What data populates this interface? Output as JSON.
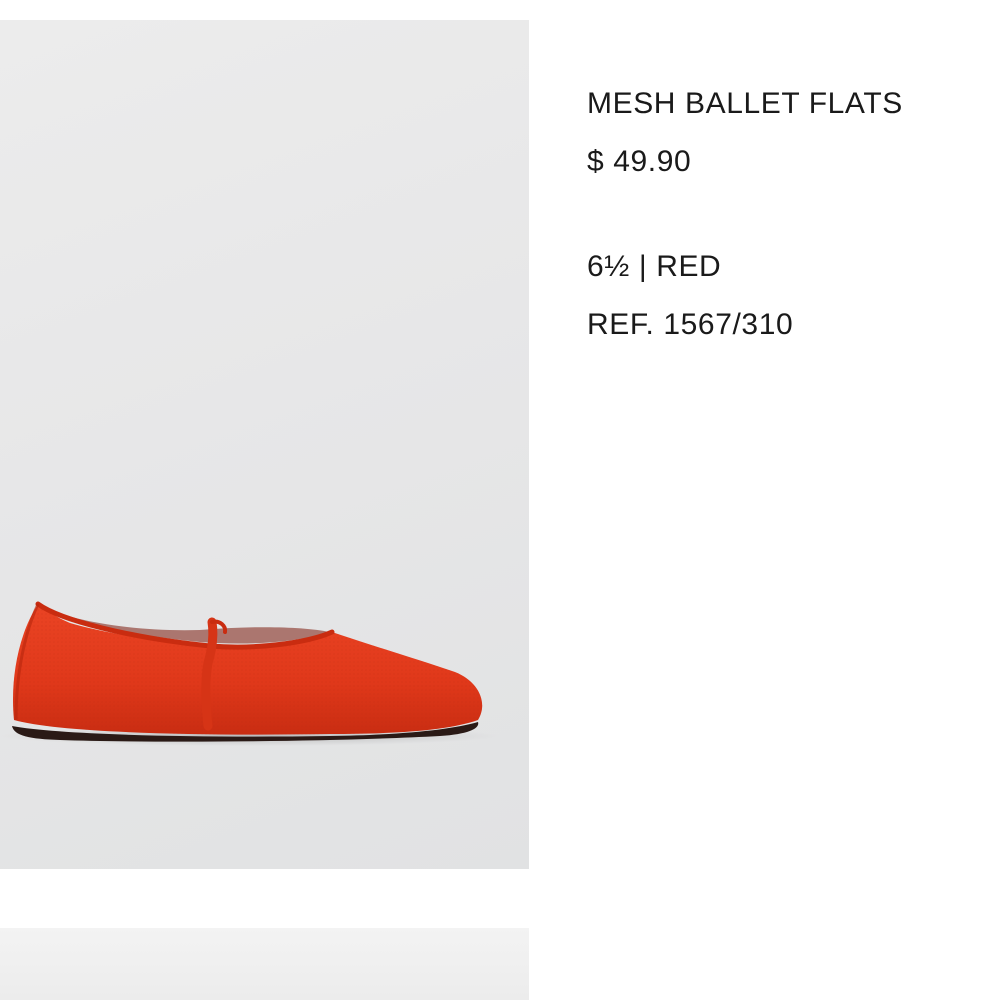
{
  "product": {
    "name": "MESH BALLET FLATS",
    "price": "$ 49.90",
    "size": "6½",
    "separator": "|",
    "color": "RED",
    "ref": "REF. 1567/310"
  },
  "images": [
    {
      "content": "red mesh ballet flat shoe on light grey background",
      "icon": "product-photo"
    },
    {
      "content": "next product photo (partially visible)",
      "icon": "product-photo"
    }
  ],
  "colors": {
    "shoe": "#e23a1c",
    "background": "#ffffff",
    "text": "#1a1a1a",
    "photo_bg": "#e7e7e8"
  }
}
